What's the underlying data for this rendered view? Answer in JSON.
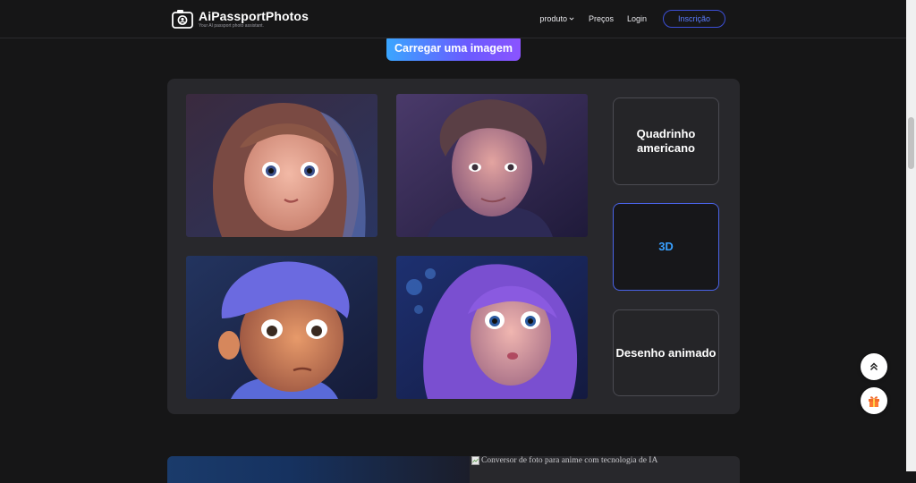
{
  "header": {
    "brand": "AiPassportPhotos",
    "tagline": "Your AI passport photo assistant.",
    "nav": {
      "product": "produto",
      "pricing": "Preços",
      "login": "Login",
      "signup": "Inscrição"
    }
  },
  "main": {
    "upload_label": "Carregar uma imagem",
    "styles": [
      "Quadrinho americano",
      "3D",
      "Desenho animado"
    ],
    "selected_style": "3D"
  },
  "bottom": {
    "broken_image_alt": "Conversor de foto para anime com tecnologia de IA"
  },
  "colors": {
    "accent": "#39a0ff",
    "signup_border": "#3c4fd6",
    "panel": "#28282c",
    "background": "#161617"
  }
}
